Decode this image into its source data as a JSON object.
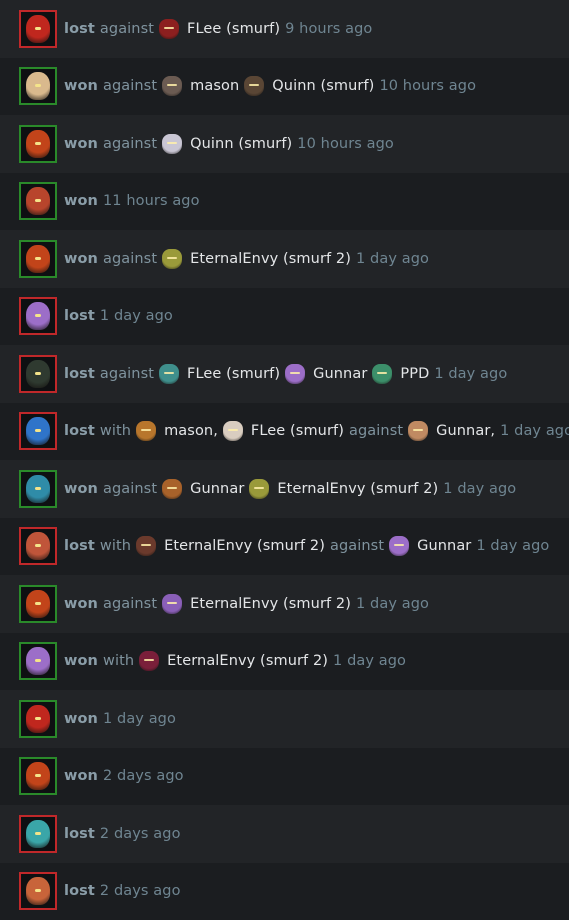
{
  "matches": [
    {
      "result": "lost",
      "hero_icon": "red-armored-hero-icon",
      "hero_color": "#c0271e",
      "segments": [
        {
          "t": "muted",
          "text": "against"
        },
        {
          "t": "player",
          "name": "FLee (smurf)",
          "icon": "red-horned-hero-icon",
          "color": "#8c1f1f"
        },
        {
          "t": "time",
          "text": "9 hours ago"
        }
      ]
    },
    {
      "result": "won",
      "hero_icon": "pale-elf-hero-icon",
      "hero_color": "#d9b98d",
      "segments": [
        {
          "t": "muted",
          "text": "against"
        },
        {
          "t": "player",
          "name": "mason",
          "icon": "grey-beast-hero-icon",
          "color": "#6b5b52"
        },
        {
          "t": "player",
          "name": "Quinn (smurf)",
          "icon": "bearded-warrior-hero-icon",
          "color": "#5a4635"
        },
        {
          "t": "time",
          "text": "10 hours ago"
        }
      ]
    },
    {
      "result": "won",
      "hero_icon": "red-armored-hero-icon",
      "hero_color": "#c2441a",
      "segments": [
        {
          "t": "muted",
          "text": "against"
        },
        {
          "t": "player",
          "name": "Quinn (smurf)",
          "icon": "pale-horned-hero-icon",
          "color": "#c9c6d4"
        },
        {
          "t": "time",
          "text": "10 hours ago"
        }
      ]
    },
    {
      "result": "won",
      "hero_icon": "blue-helmet-hero-icon",
      "hero_color": "#b8452c",
      "segments": [
        {
          "t": "time",
          "text": "11 hours ago"
        }
      ]
    },
    {
      "result": "won",
      "hero_icon": "red-armored-hero-icon",
      "hero_color": "#c2441a",
      "segments": [
        {
          "t": "muted",
          "text": "against"
        },
        {
          "t": "player",
          "name": "EternalEnvy (smurf 2)",
          "icon": "green-gold-hero-icon",
          "color": "#9a9a3a"
        },
        {
          "t": "time",
          "text": "1 day ago"
        }
      ]
    },
    {
      "result": "lost",
      "hero_icon": "purple-ghost-hero-icon",
      "hero_color": "#9c6ec8",
      "segments": [
        {
          "t": "time",
          "text": "1 day ago"
        }
      ]
    },
    {
      "result": "lost",
      "hero_icon": "dark-hooded-hero-icon",
      "hero_color": "#2f3a30",
      "segments": [
        {
          "t": "muted",
          "text": "against"
        },
        {
          "t": "player",
          "name": "FLee (smurf)",
          "icon": "teal-tusk-hero-icon",
          "color": "#3f8f8c"
        },
        {
          "t": "player",
          "name": "Gunnar",
          "icon": "purple-ghost-hero-icon",
          "color": "#9c6ec8"
        },
        {
          "t": "player",
          "name": "PPD",
          "icon": "green-toothy-hero-icon",
          "color": "#3c8f6a"
        },
        {
          "t": "time",
          "text": "1 day ago"
        }
      ]
    },
    {
      "result": "lost",
      "hero_icon": "blue-dragon-hero-icon",
      "hero_color": "#2f74c9",
      "segments": [
        {
          "t": "muted",
          "text": "with"
        },
        {
          "t": "player",
          "name": "mason,",
          "icon": "orange-spiky-hero-icon",
          "color": "#b8762c"
        },
        {
          "t": "player",
          "name": "FLee (smurf)",
          "icon": "white-clown-hero-icon",
          "color": "#d9cdc0"
        },
        {
          "t": "muted",
          "text": "against"
        },
        {
          "t": "player",
          "name": "Gunnar,",
          "icon": "bald-monk-hero-icon",
          "color": "#c08a62"
        },
        {
          "t": "time",
          "text": "1 day ago"
        }
      ]
    },
    {
      "result": "won",
      "hero_icon": "teal-masked-hero-icon",
      "hero_color": "#2f8ca8",
      "segments": [
        {
          "t": "muted",
          "text": "against"
        },
        {
          "t": "player",
          "name": "Gunnar",
          "icon": "orange-warrior-hero-icon",
          "color": "#a8622a"
        },
        {
          "t": "player",
          "name": "EternalEnvy (smurf 2)",
          "icon": "green-gold-hero-icon",
          "color": "#9a9a3a"
        },
        {
          "t": "time",
          "text": "1 day ago"
        }
      ]
    },
    {
      "result": "lost",
      "hero_icon": "red-monkey-hero-icon",
      "hero_color": "#c0553a",
      "segments": [
        {
          "t": "muted",
          "text": "with"
        },
        {
          "t": "player",
          "name": "EternalEnvy (smurf 2)",
          "icon": "dark-beast-hero-icon",
          "color": "#6b3a2c"
        },
        {
          "t": "muted",
          "text": "against"
        },
        {
          "t": "player",
          "name": "Gunnar",
          "icon": "purple-ghost-hero-icon",
          "color": "#9c6ec8"
        },
        {
          "t": "time",
          "text": "1 day ago"
        }
      ]
    },
    {
      "result": "won",
      "hero_icon": "red-armored-hero-icon",
      "hero_color": "#c2441a",
      "segments": [
        {
          "t": "muted",
          "text": "against"
        },
        {
          "t": "player",
          "name": "EternalEnvy (smurf 2)",
          "icon": "violet-beast-hero-icon",
          "color": "#8a5fb8"
        },
        {
          "t": "time",
          "text": "1 day ago"
        }
      ]
    },
    {
      "result": "won",
      "hero_icon": "purple-ghost-hero-icon",
      "hero_color": "#9c6ec8",
      "segments": [
        {
          "t": "muted",
          "text": "with"
        },
        {
          "t": "player",
          "name": "EternalEnvy (smurf 2)",
          "icon": "crimson-demon-hero-icon",
          "color": "#7a1f3a"
        },
        {
          "t": "time",
          "text": "1 day ago"
        }
      ]
    },
    {
      "result": "won",
      "hero_icon": "red-armored-hero-icon",
      "hero_color": "#c0271e",
      "segments": [
        {
          "t": "time",
          "text": "1 day ago"
        }
      ]
    },
    {
      "result": "won",
      "hero_icon": "red-armored-hero-icon",
      "hero_color": "#c2441a",
      "segments": [
        {
          "t": "time",
          "text": "2 days ago"
        }
      ]
    },
    {
      "result": "lost",
      "hero_icon": "cyan-horned-hero-icon",
      "hero_color": "#3aa6a8",
      "segments": [
        {
          "t": "time",
          "text": "2 days ago"
        }
      ]
    },
    {
      "result": "lost",
      "hero_icon": "red-haired-hero-icon",
      "hero_color": "#c8643a",
      "segments": [
        {
          "t": "time",
          "text": "2 days ago"
        }
      ]
    }
  ]
}
